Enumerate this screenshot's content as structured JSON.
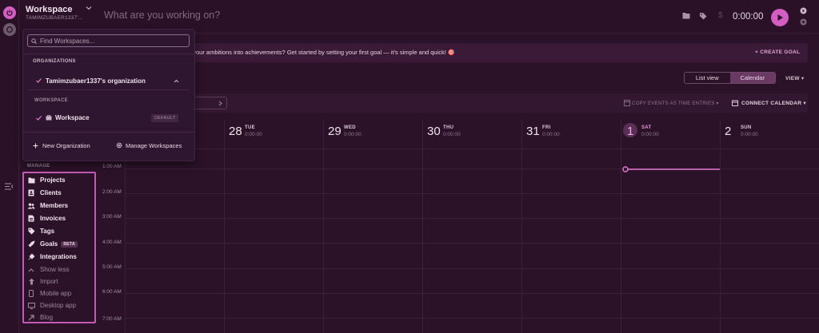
{
  "workspace": {
    "name": "Workspace",
    "sub": "TAMIMZUBAER1337'..."
  },
  "topbar": {
    "placeholder": "What are you working on?",
    "currency_icon": "$",
    "timer": "0:00:00"
  },
  "banner": {
    "text": "n your ambitions into achievements? Get started by setting your first goal — it's simple and quick! 🎯",
    "create_goal": "+ CREATE GOAL"
  },
  "view": {
    "list_view": "List view",
    "calendar": "Calendar",
    "view_menu": "VIEW ▾"
  },
  "toolbar": {
    "copy_events": "COPY EVENTS AS TIME ENTRIES ▾",
    "connect_calendar": "CONNECT CALENDAR ▾"
  },
  "calendar": {
    "days": [
      {
        "num": "28",
        "name": "TUE",
        "time": "0:00:00"
      },
      {
        "num": "29",
        "name": "WED",
        "time": "0:00:00"
      },
      {
        "num": "30",
        "name": "THU",
        "time": "0:00:00"
      },
      {
        "num": "31",
        "name": "FRI",
        "time": "0:00:00"
      },
      {
        "num": "1",
        "name": "SAT",
        "time": "0:00:00"
      },
      {
        "num": "2",
        "name": "SUN",
        "time": "0:00:00"
      }
    ],
    "hours": [
      "1:00 AM",
      "2:00 AM",
      "3:00 AM",
      "4:00 AM",
      "5:00 AM",
      "6:00 AM",
      "7:00 AM"
    ]
  },
  "dropdown": {
    "search_placeholder": "Find Workspaces...",
    "organizations_label": "ORGANIZATIONS",
    "org_name": "Tamimzubaer1337's organization",
    "workspace_label": "WORKSPACE",
    "workspace_name": "Workspace",
    "default_badge": "DEFAULT",
    "new_org": "New Organization",
    "manage_workspaces": "Manage Workspaces"
  },
  "manage": {
    "label": "MANAGE",
    "items": [
      {
        "label": "Projects",
        "icon": "folder-icon"
      },
      {
        "label": "Clients",
        "icon": "client-icon"
      },
      {
        "label": "Members",
        "icon": "members-icon"
      },
      {
        "label": "Invoices",
        "icon": "invoice-icon"
      },
      {
        "label": "Tags",
        "icon": "tag-icon"
      },
      {
        "label": "Goals",
        "icon": "rocket-icon",
        "badge": "BETA"
      },
      {
        "label": "Integrations",
        "icon": "plug-icon"
      },
      {
        "label": "Show less",
        "icon": "chevron-up-icon"
      },
      {
        "label": "Import",
        "icon": "import-icon"
      },
      {
        "label": "Mobile app",
        "icon": "mobile-icon"
      },
      {
        "label": "Desktop app",
        "icon": "desktop-icon"
      },
      {
        "label": "Blog",
        "icon": "external-link-icon"
      }
    ]
  },
  "colors": {
    "accent": "#d45dc4",
    "bg": "#2b1229",
    "highlight_border": "#c35ab3"
  }
}
